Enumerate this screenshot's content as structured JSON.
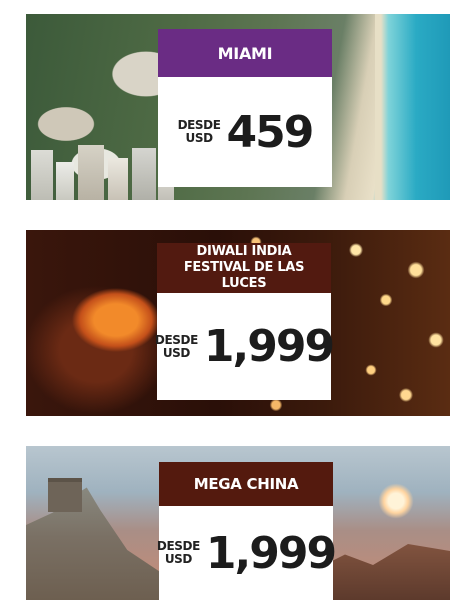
{
  "banners": [
    {
      "destination": "MIAMI",
      "desde": "DESDE",
      "currency": "USD",
      "price": "459",
      "header_color": "#6a2c84"
    },
    {
      "destination_line1": "DIWALI INDIA",
      "destination_line2": "FESTIVAL DE LAS LUCES",
      "desde": "DESDE",
      "currency": "USD",
      "price": "1,999",
      "header_color": "#521a10"
    },
    {
      "destination": "MEGA CHINA",
      "desde": "DESDE",
      "currency": "USD",
      "price": "1,999",
      "header_color": "#541a0e"
    }
  ]
}
